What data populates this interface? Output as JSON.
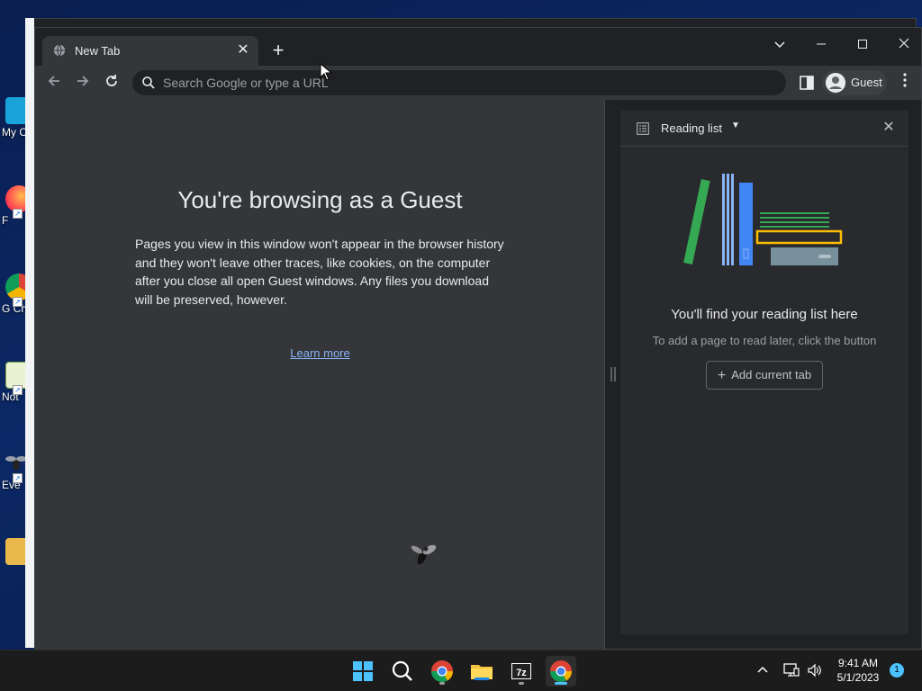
{
  "desktop": {
    "icons": [
      {
        "label": "My C"
      },
      {
        "label": "F"
      },
      {
        "label": "G Ch"
      },
      {
        "label": "Not"
      },
      {
        "label": "Eve"
      }
    ]
  },
  "browser": {
    "tab": {
      "title": "New Tab"
    },
    "omnibox": {
      "placeholder": "Search Google or type a URL"
    },
    "profile": {
      "name": "Guest"
    }
  },
  "content": {
    "title": "You're browsing as a Guest",
    "body": "Pages you view in this window won't appear in the browser history and they won't leave other traces, like cookies, on the computer after you close all open Guest windows. Any files you download will be preserved, however.",
    "learn_more": "Learn more"
  },
  "panel": {
    "title": "Reading list",
    "empty_title": "You'll find your reading list here",
    "empty_sub": "To add a page to read later, click the button",
    "add_button": "Add current tab"
  },
  "taskbar": {
    "time": "9:41 AM",
    "date": "5/1/2023",
    "notifications": "1"
  },
  "colors": {
    "accent": "#8ab4f8",
    "taskbar_active": "#4cc2ff"
  }
}
